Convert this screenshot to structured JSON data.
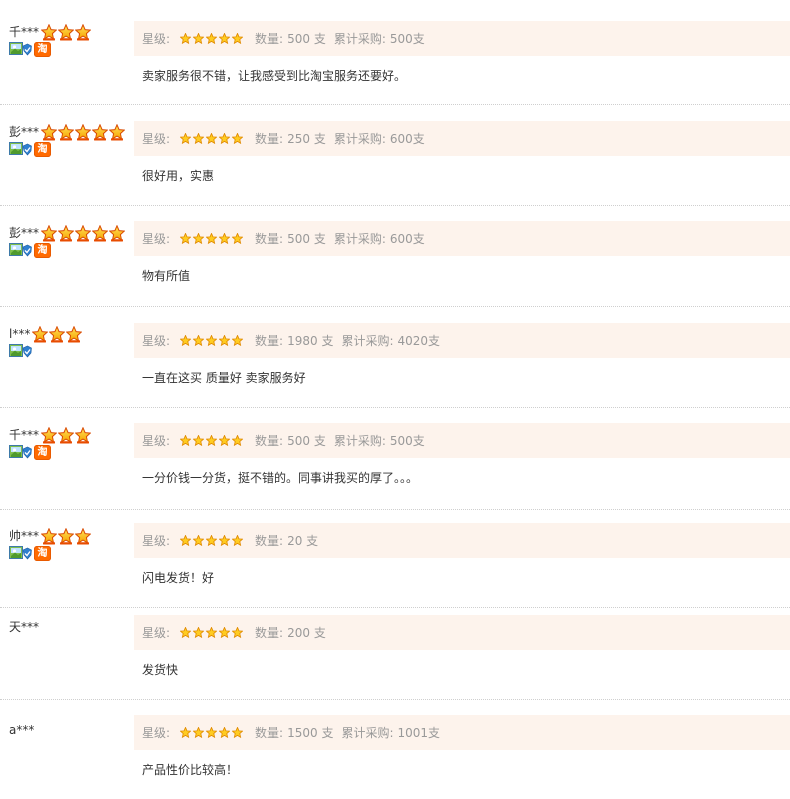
{
  "labels": {
    "rating": "星级:",
    "quantity": "数量:",
    "cumulative": "累计采购:"
  },
  "reviews": [
    {
      "user": "千***",
      "crowns": 3,
      "id_badge": true,
      "tao_badge": true,
      "tao_text": "淘",
      "rating": 5,
      "quantity": "500 支",
      "cumulative": "500支",
      "comment": "卖家服务很不错，让我感受到比淘宝服务还要好。"
    },
    {
      "user": "彭***",
      "crowns": 5,
      "id_badge": true,
      "tao_badge": true,
      "tao_text": "淘",
      "rating": 5,
      "quantity": "250 支",
      "cumulative": "600支",
      "comment": "很好用，实惠"
    },
    {
      "user": "彭***",
      "crowns": 5,
      "id_badge": true,
      "tao_badge": true,
      "tao_text": "淘",
      "rating": 5,
      "quantity": "500 支",
      "cumulative": "600支",
      "comment": "物有所值"
    },
    {
      "user": "l***",
      "crowns": 3,
      "id_badge": true,
      "tao_badge": false,
      "tao_text": "",
      "rating": 5,
      "quantity": "1980 支",
      "cumulative": "4020支",
      "comment": "一直在这买 质量好 卖家服务好"
    },
    {
      "user": "千***",
      "crowns": 3,
      "id_badge": true,
      "tao_badge": true,
      "tao_text": "淘",
      "rating": 5,
      "quantity": "500 支",
      "cumulative": "500支",
      "comment": "一分价钱一分货，挺不错的。同事讲我买的厚了。。。"
    },
    {
      "user": "帅***",
      "crowns": 3,
      "id_badge": true,
      "tao_badge": true,
      "tao_text": "淘",
      "rating": 5,
      "quantity": "20 支",
      "cumulative": "",
      "comment": "闪电发货！好"
    },
    {
      "user": "天***",
      "crowns": 0,
      "id_badge": false,
      "tao_badge": false,
      "tao_text": "",
      "rating": 5,
      "quantity": "200 支",
      "cumulative": "",
      "comment": "发货快"
    },
    {
      "user": "a***",
      "crowns": 0,
      "id_badge": false,
      "tao_badge": false,
      "tao_text": "",
      "rating": 5,
      "quantity": "1500 支",
      "cumulative": "1001支",
      "comment": "产品性价比较高！"
    }
  ]
}
